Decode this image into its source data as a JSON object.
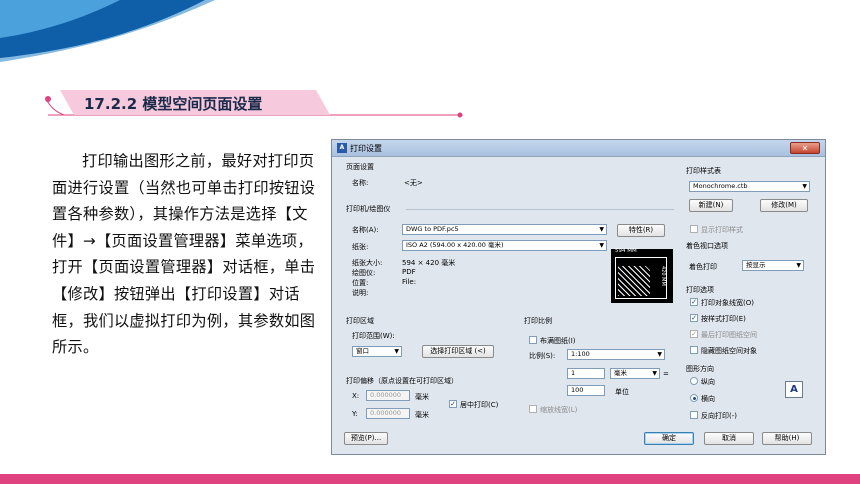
{
  "slide": {
    "section_title": "17.2.2 模型空间页面设置",
    "body_text": "打印输出图形之前，最好对打印页面进行设置（当然也可单击打印按钮设置各种参数），其操作方法是选择【文件】→【页面设置管理器】菜单选项，打开【页面设置管理器】对话框，单击【修改】按钮弹出【打印设置】对话框，我们以虚拟打印为例，其参数如图所示。",
    "colors": {
      "accent_pink": "#e0417f",
      "accent_blue": "#1f7fc8",
      "banner_pink": "#f7c9dc"
    }
  },
  "dialog": {
    "title": "打印设置",
    "close_label": "✕",
    "page_setup": {
      "group": "页面设置",
      "name_label": "名称:",
      "name_value": "<无>"
    },
    "printer": {
      "group": "打印机/绘图仪",
      "name_label": "名称(A):",
      "name_value": "DWG to PDF.pc5",
      "properties_button": "特性(R)",
      "paper_label": "纸张:",
      "paper_value": "ISO A2 (594.00 x 420.00 毫米)",
      "paper_size_label": "纸张大小:",
      "paper_size_value": "594 × 420  毫米",
      "plotter_label": "绘图仪:",
      "plotter_value": "PDF",
      "location_label": "位置:",
      "location_value": "File:",
      "description_label": "说明:",
      "preview_width": "594 MM",
      "preview_height": "420 MM"
    },
    "plot_area": {
      "group": "打印区域",
      "range_label": "打印范围(W):",
      "range_value": "窗口",
      "select_button": "选择打印区域 (<)"
    },
    "plot_scale": {
      "group": "打印比例",
      "fit_paper": "布满图纸(I)",
      "scale_label": "比例(S):",
      "scale_value": "1:100",
      "value1": "1",
      "unit1": "毫米",
      "equals": "=",
      "value2": "100",
      "unit2": "单位",
      "scale_lineweights": "缩放线宽(L)"
    },
    "plot_offset": {
      "group": "打印偏移（原点设置在可打印区域）",
      "x_label": "X:",
      "x_value": "0.000000",
      "x_unit": "毫米",
      "y_label": "Y:",
      "y_value": "0.000000",
      "y_unit": "毫米",
      "center_plot": "居中打印(C)"
    },
    "plot_style": {
      "group": "打印样式表",
      "value": "Monochrome.ctb",
      "new_button": "新建(N)",
      "edit_button": "修改(M)",
      "display_styles": "显示打印样式"
    },
    "shaded": {
      "group": "着色视口选项",
      "shade_label": "着色打印",
      "shade_value": "按显示"
    },
    "options": {
      "group": "打印选项",
      "items": [
        {
          "label": "打印对象线宽(O)",
          "checked": true,
          "enabled": true
        },
        {
          "label": "按样式打印(E)",
          "checked": true,
          "enabled": true
        },
        {
          "label": "最后打印图纸空间",
          "checked": true,
          "enabled": false
        },
        {
          "label": "隐藏图纸空间对象",
          "checked": false,
          "enabled": true
        }
      ]
    },
    "orientation": {
      "group": "图形方向",
      "portrait": "纵向",
      "landscape": "横向",
      "upside_down": "反向打印(-)",
      "icon_letter": "A"
    },
    "footer": {
      "preview_button": "预览(P)...",
      "ok_button": "确定",
      "cancel_button": "取消",
      "help_button": "帮助(H)"
    }
  }
}
